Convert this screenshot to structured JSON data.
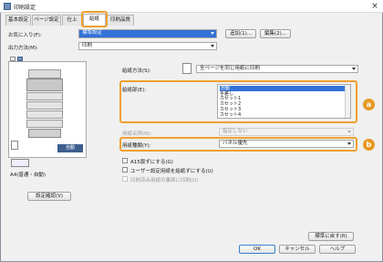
{
  "window": {
    "title": "印刷設定",
    "close_glyph": "×"
  },
  "tabs": [
    {
      "label": "基本設定"
    },
    {
      "label": "ページ設定"
    },
    {
      "label": "仕上"
    },
    {
      "label": "給紙"
    },
    {
      "label": "印刷品質"
    }
  ],
  "favorites": {
    "label": "お気に入り(F):",
    "value": "標準設定",
    "add_button": "追加(1)...",
    "edit_button": "編集(2)..."
  },
  "output": {
    "label": "出力方法(M):",
    "value": "印刷"
  },
  "preview": {
    "caption": "A4(普通・自動)",
    "auto_label": "自動",
    "settings_button": "設定確認(V)"
  },
  "paper_source_method": {
    "label": "給紙方法(S):",
    "value": "全ページを同じ用紙に印刷"
  },
  "paper_source": {
    "label": "給紙部(E):",
    "items": [
      "自動",
      "手差し",
      "カセット1",
      "カセット2",
      "カセット3",
      "カセット4"
    ],
    "selected_index": 0
  },
  "paper_name": {
    "label": "用紙名称(N):",
    "value": "指定しない"
  },
  "paper_type": {
    "label": "用紙種類(Y):",
    "value": "バネル優先"
  },
  "checkboxes": [
    {
      "label": "A15版ずにする(G)",
      "checked": false,
      "enabled": true
    },
    {
      "label": "ユーザー設定用紙を給紙ずにする(U)",
      "checked": false,
      "enabled": true
    },
    {
      "label": "印刷済み用紙の裏面に印刷(D)",
      "checked": false,
      "enabled": false
    }
  ],
  "restore_button": "標準に戻す(R)",
  "footer": {
    "ok": "OK",
    "cancel": "キャンセル",
    "help": "ヘルプ"
  },
  "callouts": {
    "a": "a",
    "b": "b"
  },
  "colors": {
    "highlight": "#f0a030",
    "badge": "#e69a24",
    "selection": "#3371d6"
  }
}
